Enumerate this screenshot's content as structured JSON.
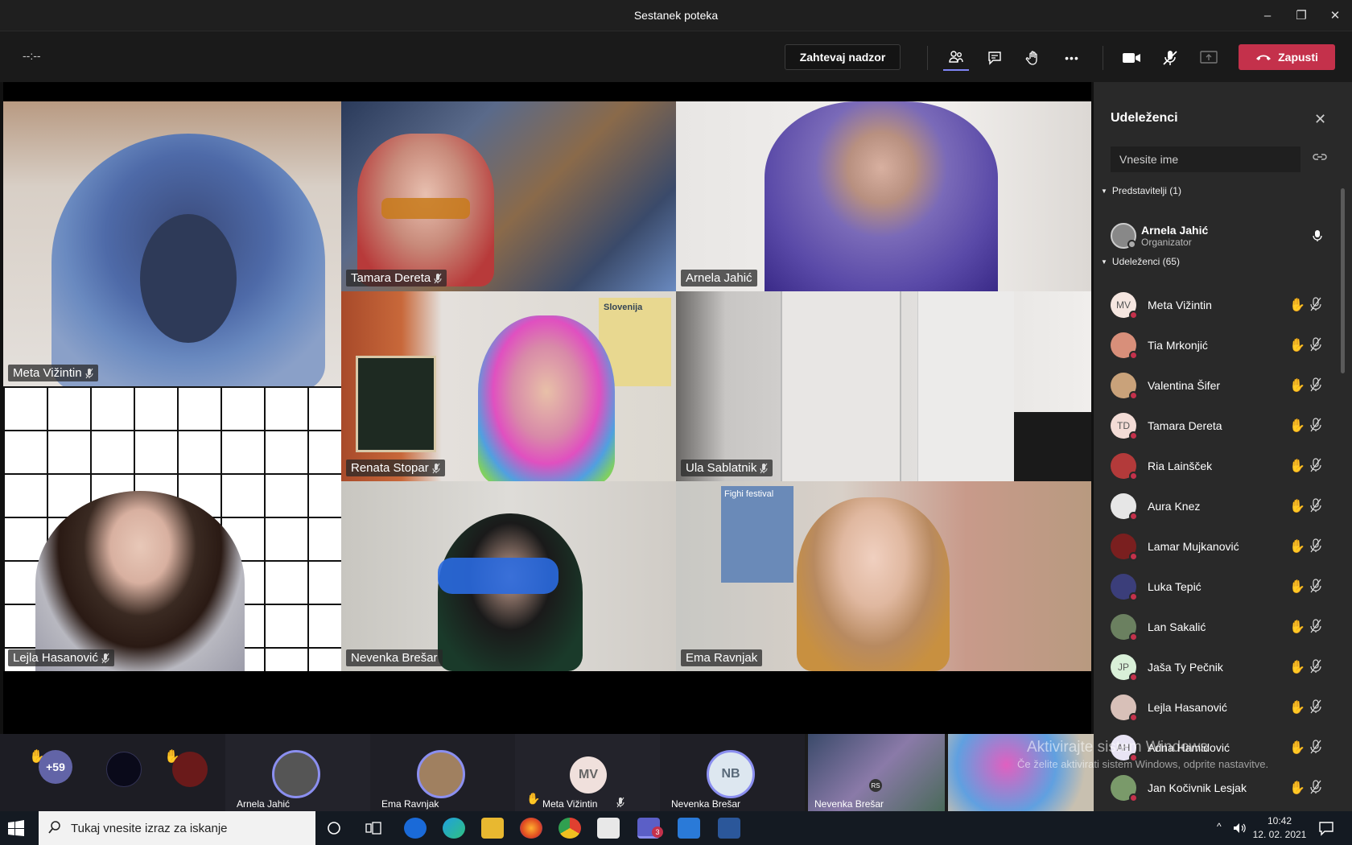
{
  "window": {
    "title": "Sestanek poteka",
    "min": "–",
    "max": "❐",
    "close": "✕"
  },
  "toolbar": {
    "timer": "--:--",
    "request_control": "Zahtevaj nadzor",
    "more": "•••",
    "hangup_label": "Zapusti"
  },
  "tiles": [
    {
      "name": "Meta Vižintin"
    },
    {
      "name": "Tamara Dereta"
    },
    {
      "name": "Arnela Jahić"
    },
    {
      "name": "Renata Stopar"
    },
    {
      "name": "Ula Sablatnik"
    },
    {
      "name": "Lejla Hasanović"
    },
    {
      "name": "Nevenka Brešar"
    },
    {
      "name": "Ema Ravnjak"
    }
  ],
  "poster_text": "Slovenija",
  "festival_text": "Fighi festival",
  "panel": {
    "title": "Udeleženci",
    "search_placeholder": "Vnesite ime",
    "presenters_header": "Predstavitelji (1)",
    "organizer": {
      "name": "Arnela Jahić",
      "role": "Organizator"
    },
    "attendees_header": "Udeleženci (65)",
    "attendees": [
      {
        "name": "Meta Vižintin",
        "initials": "MV",
        "color": "#f5e6e0"
      },
      {
        "name": "Tia Mrkonjić",
        "initials": "",
        "color": "#d88f7a"
      },
      {
        "name": "Valentina Šifer",
        "initials": "",
        "color": "#c9a27a"
      },
      {
        "name": "Tamara Dereta",
        "initials": "TD",
        "color": "#f3dcd6"
      },
      {
        "name": "Ria Lainšček",
        "initials": "",
        "color": "#b33a3a"
      },
      {
        "name": "Aura Knez",
        "initials": "",
        "color": "#e6e6e6"
      },
      {
        "name": "Lamar Mujkanović",
        "initials": "",
        "color": "#7a1f1f"
      },
      {
        "name": "Luka Tepić",
        "initials": "",
        "color": "#3b3e7a"
      },
      {
        "name": "Lan Sakalić",
        "initials": "",
        "color": "#6b8060"
      },
      {
        "name": "Jaša Ty Pečnik",
        "initials": "JP",
        "color": "#d9f0d8"
      },
      {
        "name": "Lejla Hasanović",
        "initials": "",
        "color": "#d8c0b8"
      },
      {
        "name": "Adna Hamidović",
        "initials": "AH",
        "color": "#e8e4f4"
      },
      {
        "name": "Jan Kočivnik Lesjak",
        "initials": "",
        "color": "#7a9a6a"
      }
    ]
  },
  "strip": {
    "overflow": "+59",
    "people": [
      {
        "name": "Arnela Jahić"
      },
      {
        "name": "Ema Ravnjak"
      },
      {
        "name": "Meta Vižintin",
        "initials": "MV"
      },
      {
        "name": "Nevenka Brešar",
        "initials": "NB"
      }
    ],
    "share_label": "Nevenka Brešar",
    "share_badge": "RS"
  },
  "watermark": {
    "line1": "Aktivirajte sistem Windows",
    "line2": "Če želite aktivirati sistem Windows, odprite nastavitve."
  },
  "taskbar": {
    "search_placeholder": "Tukaj vnesite izraz za iskanje",
    "teams_badge": "3",
    "time": "10:42",
    "date": "12. 02. 2021"
  },
  "colors": {
    "accent": "#7f85f5",
    "hangup": "#c4314b",
    "panel": "#292929"
  }
}
